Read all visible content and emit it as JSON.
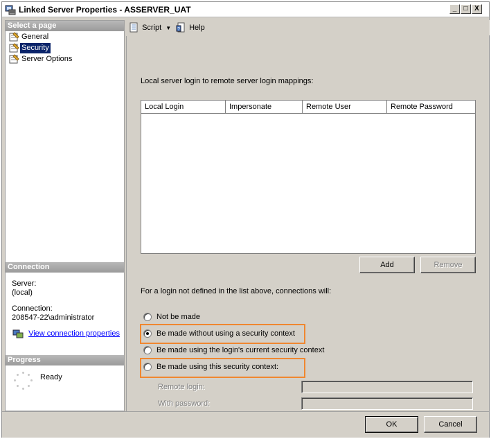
{
  "window": {
    "title": "Linked Server Properties - ASSERVER_UAT",
    "controls": [
      "_",
      "□",
      "X"
    ]
  },
  "left_panel": {
    "select_page_header": "Select a page",
    "pages": [
      {
        "label": "General",
        "icon": "page-icon",
        "selected": false
      },
      {
        "label": "Security",
        "icon": "page-icon",
        "selected": true
      },
      {
        "label": "Server Options",
        "icon": "page-icon",
        "selected": false
      }
    ],
    "connection_header": "Connection",
    "server_label": "Server:",
    "server_value": "(local)",
    "connection_label": "Connection:",
    "connection_value": "208547-22\\administrator",
    "view_connection_link": "View connection properties",
    "progress_header": "Progress",
    "progress_status": "Ready"
  },
  "toolbar": {
    "script_label": "Script",
    "help_label": "Help"
  },
  "security": {
    "mappings_label": "Local server login to remote server login mappings:",
    "grid_columns": [
      "Local Login",
      "Impersonate",
      "Remote User",
      "Remote Password"
    ],
    "grid_rows": [],
    "add_button": "Add",
    "remove_button": "Remove",
    "connections_label": "For a login not defined in the list above, connections will:",
    "options": [
      {
        "label": "Not be made",
        "checked": false
      },
      {
        "label": "Be made without using a security context",
        "checked": true
      },
      {
        "label": "Be made using the login's current security context",
        "checked": false
      },
      {
        "label": "Be made using this security context:",
        "checked": false
      }
    ],
    "remote_login_label": "Remote login:",
    "remote_login_value": "",
    "password_label": "With password:",
    "password_value": "",
    "highlight_color": "#f0872f"
  },
  "footer": {
    "ok_button": "OK",
    "cancel_button": "Cancel"
  }
}
